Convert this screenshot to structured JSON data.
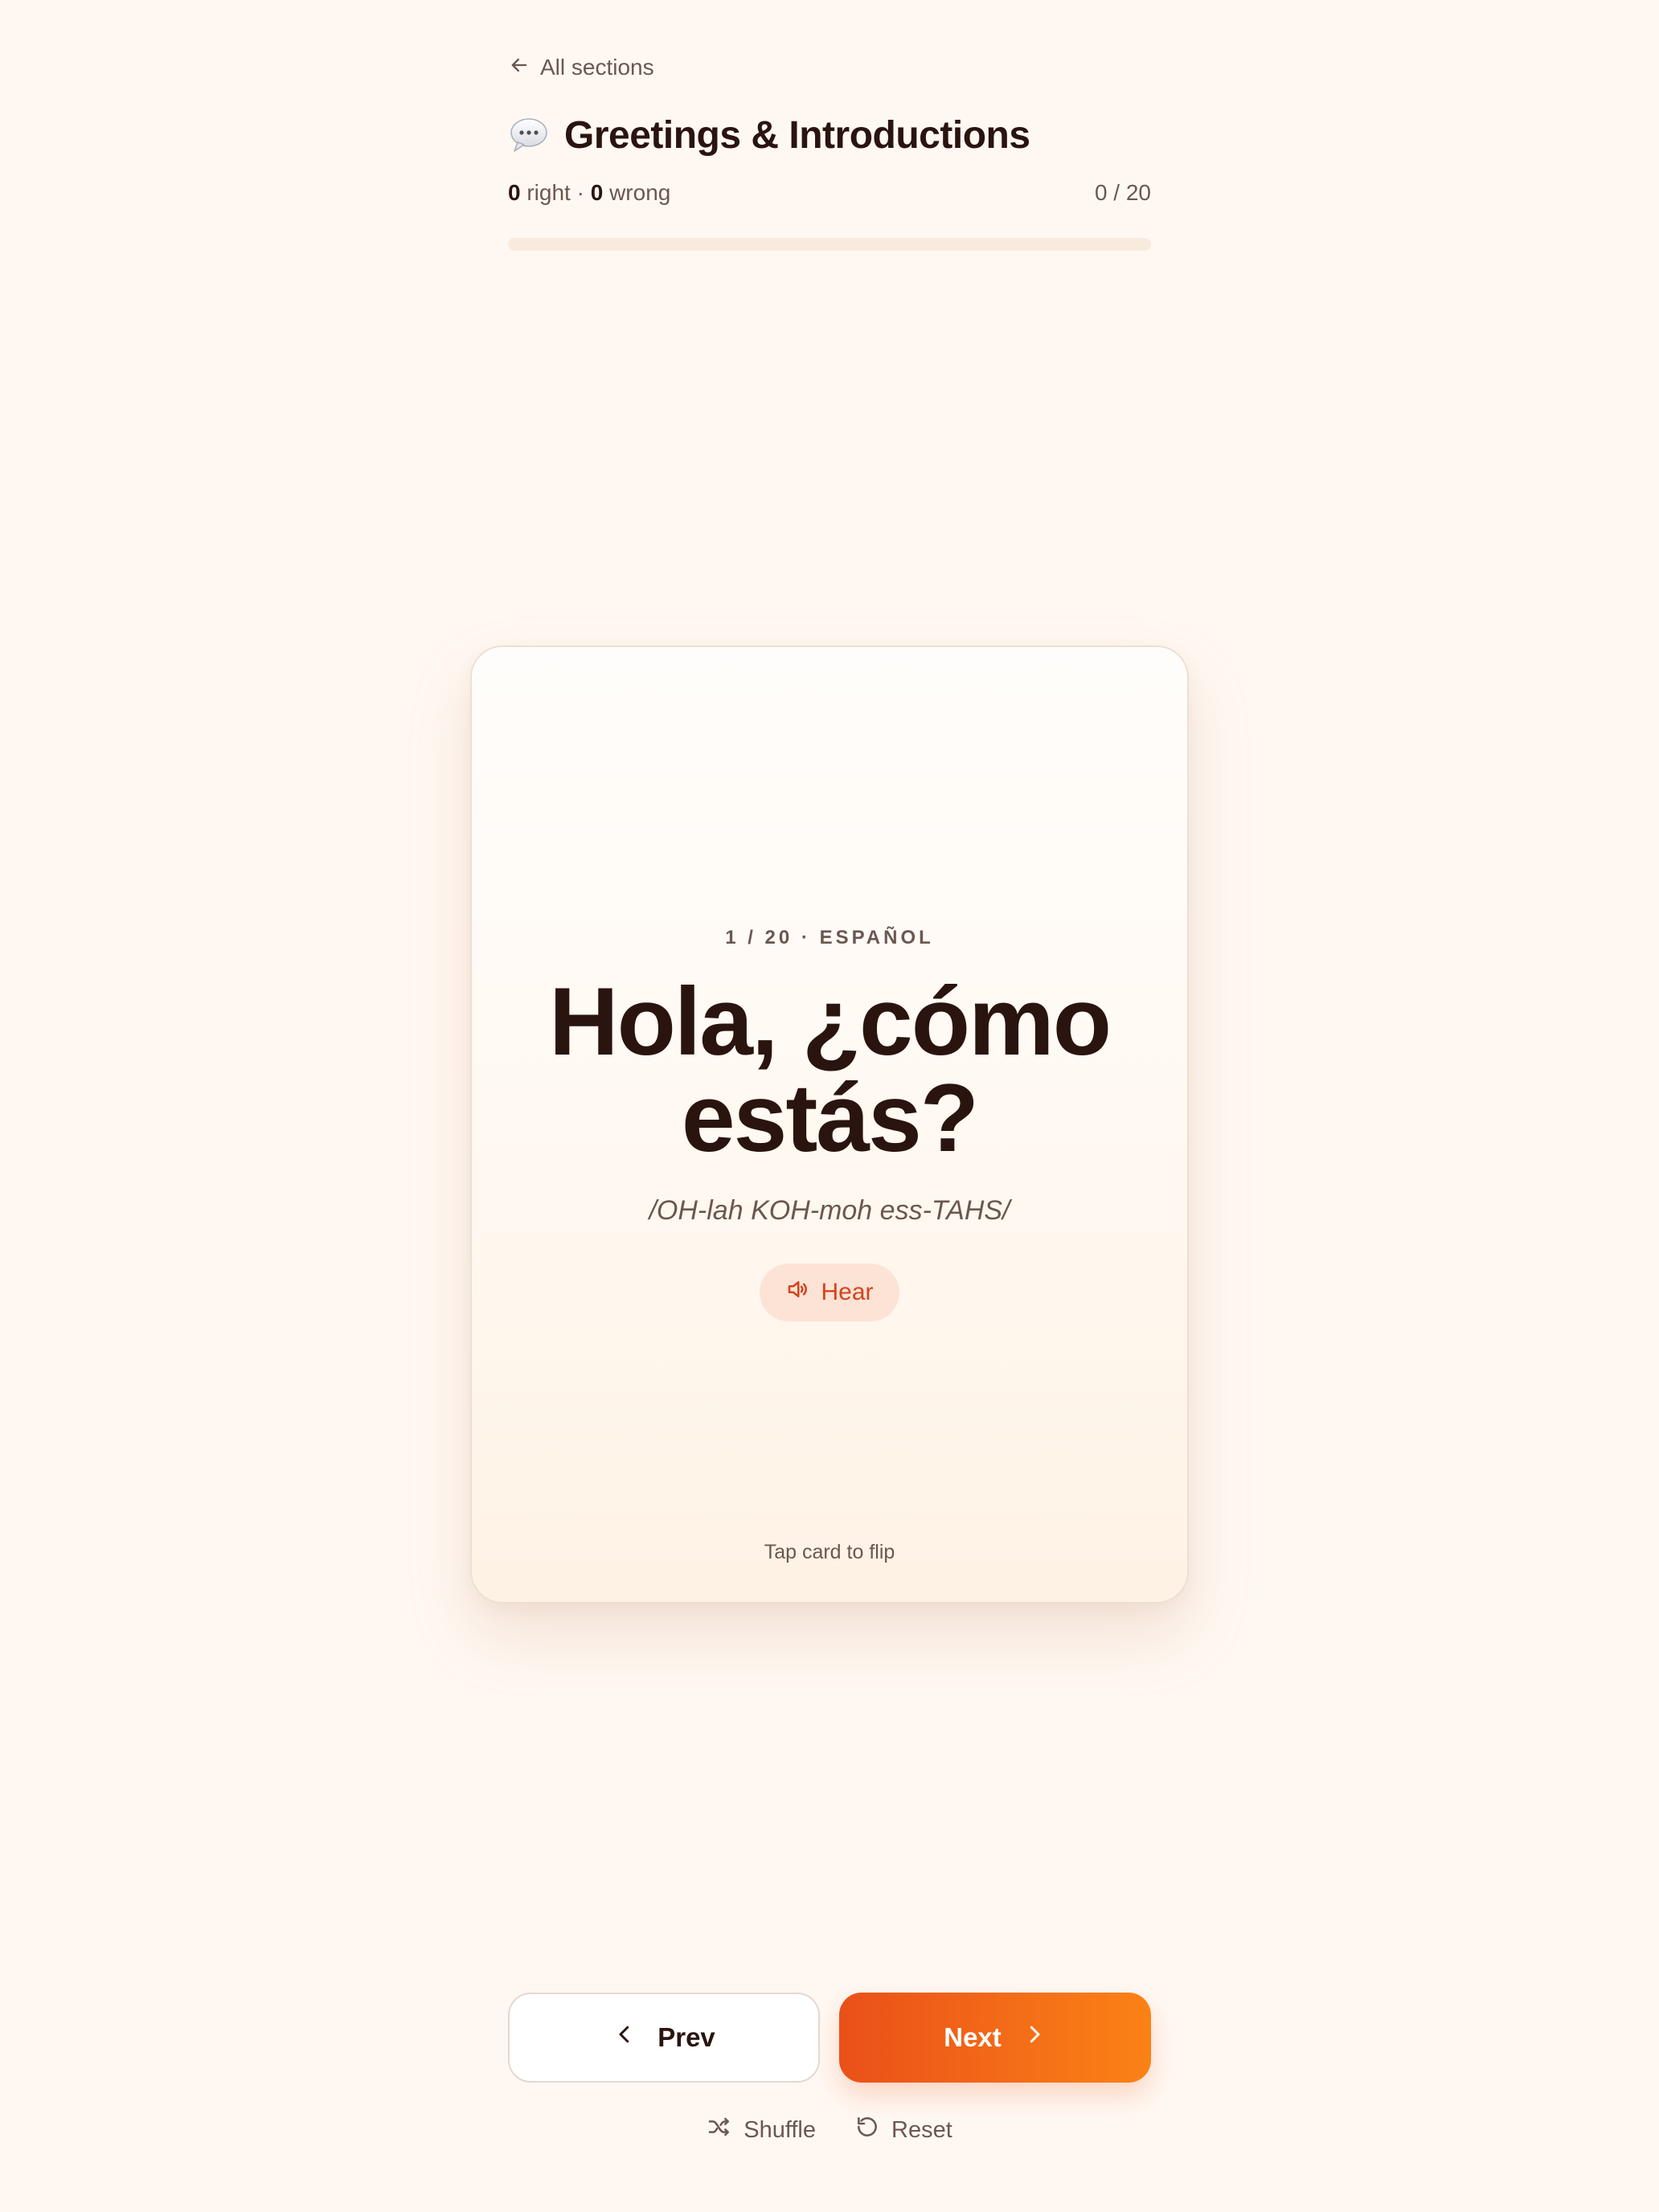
{
  "header": {
    "back_label": "All sections",
    "title": "Greetings & Introductions",
    "title_icon": "speech-bubble-icon",
    "right_count": "0",
    "right_label": "right",
    "separator": "·",
    "wrong_count": "0",
    "wrong_label": "wrong",
    "progress_text": "0 / 20",
    "progress_fraction": 0
  },
  "card": {
    "meta": "1 / 20 · ESPAÑOL",
    "phrase": "Hola, ¿cómo estás?",
    "pronunciation": "/OH-lah KOH-moh ess-TAHS/",
    "hear_label": "Hear",
    "tap_hint": "Tap card to flip"
  },
  "nav": {
    "prev_label": "Prev",
    "next_label": "Next"
  },
  "utilities": {
    "shuffle_label": "Shuffle",
    "reset_label": "Reset"
  },
  "colors": {
    "accent": "#ea5a1f",
    "background": "#fff8f2",
    "text": "#2a1410"
  }
}
